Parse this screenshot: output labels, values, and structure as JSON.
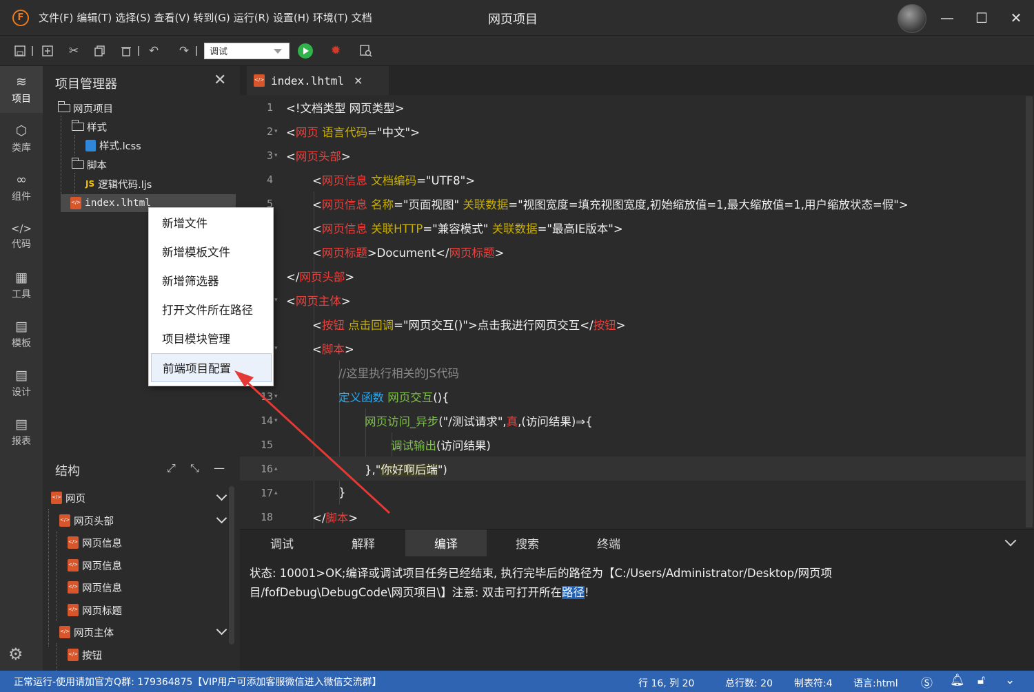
{
  "titlebar": {
    "logo": "F",
    "menus": [
      "文件(F)",
      "编辑(T)",
      "选择(S)",
      "查看(V)",
      "转到(G)",
      "运行(R)",
      "设置(H)",
      "环境(T)",
      "文档"
    ],
    "title": "网页项目",
    "minimize": "—",
    "maximize": "☐",
    "close": "✕"
  },
  "toolbar": {
    "run_mode": "调试",
    "icons": [
      "save-icon",
      "new-icon",
      "cut-icon",
      "copy-icon",
      "delete-icon",
      "undo-icon",
      "redo-icon",
      "run-icon",
      "debug-icon",
      "search-icon"
    ]
  },
  "activity": {
    "items": [
      {
        "label": "项目",
        "icon": "layers-icon"
      },
      {
        "label": "类库",
        "icon": "cube-icon"
      },
      {
        "label": "组件",
        "icon": "link-icon"
      },
      {
        "label": "代码",
        "icon": "code-icon"
      },
      {
        "label": "工具",
        "icon": "tools-icon"
      },
      {
        "label": "模板",
        "icon": "template-icon"
      },
      {
        "label": "设计",
        "icon": "design-icon"
      },
      {
        "label": "报表",
        "icon": "report-icon"
      }
    ]
  },
  "project": {
    "title": "项目管理器",
    "tree": [
      {
        "label": "网页项目",
        "type": "folder"
      },
      {
        "label": "样式",
        "type": "folder"
      },
      {
        "label": "样式.lcss",
        "type": "css"
      },
      {
        "label": "脚本",
        "type": "folder"
      },
      {
        "label": "逻辑代码.ljs",
        "type": "js"
      },
      {
        "label": "index.lhtml",
        "type": "html"
      }
    ]
  },
  "context_menu": {
    "items": [
      "新增文件",
      "新增模板文件",
      "新增筛选器",
      "打开文件所在路径",
      "项目模块管理",
      "前端项目配置"
    ]
  },
  "structure": {
    "title": "结构",
    "items": [
      "网页",
      "网页头部",
      "网页信息",
      "网页信息",
      "网页信息",
      "网页标题",
      "网页主体",
      "按钮"
    ]
  },
  "editor": {
    "tab": "index.lhtml",
    "line_numbers": [
      "1",
      "2",
      "3",
      "4",
      "5",
      "6",
      "7",
      "8",
      "9",
      "10",
      "11",
      "12",
      "13",
      "14",
      "15",
      "16",
      "17",
      "18"
    ],
    "lines": {
      "l1": "<!文档类型 网页类型>",
      "l2a": "<",
      "l2b": "网页",
      "l2c": " 语言代码",
      "l2d": "=\"中文\">",
      "l3b": "网页头部",
      "l4b": "网页信息",
      "l4c": " 文档编码",
      "l4d": "=\"UTF8\">",
      "l5b": "网页信息",
      "l5c": " 名称",
      "l5d": "=\"页面视图\"",
      "l5e": " 关联数据",
      "l5f": "=\"视图宽度=填充视图宽度,初始缩放值=1,最大缩放值=1,用户缩放状态=假\">",
      "l6b": "网页信息",
      "l6c": " 关联HTTP",
      "l6d": "=\"兼容模式\"",
      "l6e": " 关联数据",
      "l6f": "=\"最高IE版本\">",
      "l7b": "网页标题",
      "l7c": ">Document</",
      "l7d": "网页标题",
      "l8b": "网页头部",
      "l9b": "网页主体",
      "l10b": "按钮",
      "l10c": " 点击回调",
      "l10d": "=\"网页交互()\">点击我进行网页交互</",
      "l10e": "按钮",
      "l11b": "脚本",
      "l12": "//这里执行相关的JS代码",
      "l13a": "定义函数",
      "l13b": " 网页交互",
      "l13c": "(){",
      "l14a": "网页访问_异步",
      "l14b": "(\"/测试请求\",",
      "l14c": "真",
      "l14d": ",(访问结果)⇒{",
      "l15a": "调试输出",
      "l15b": "(访问结果)",
      "l16a": "},\"",
      "l16b": "你好啊后端",
      "l16c": "\")",
      "l17": "}",
      "l18b": "脚本"
    }
  },
  "bottom": {
    "tabs": [
      "调试",
      "解释",
      "编译",
      "搜索",
      "终端"
    ],
    "active_tab": "编译",
    "output_line1": "状态: 10001>OK;编译或调试项目任务已经结束, 执行完毕后的路径为【C:/Users/Administrator/Desktop/网页项",
    "output_line2a": "目/fofDebug\\DebugCode\\网页项目\\】注意: 双击可打开所在",
    "output_line2b": "路径",
    "output_line2c": "!"
  },
  "status": {
    "left": "正常运行-使用请加官方Q群: 179364875【VIP用户可添加客服微信进入微信交流群】",
    "position": "行 16, 列 20",
    "total": "总行数: 20",
    "tab": "制表符:4",
    "lang": "语言:html"
  },
  "colors": {
    "accent": "#2f64b2",
    "tag": "#e8413d",
    "attr": "#c9b000",
    "keyword": "#2aa8f0",
    "function": "#7fc04b",
    "arrow": "#e53935"
  }
}
